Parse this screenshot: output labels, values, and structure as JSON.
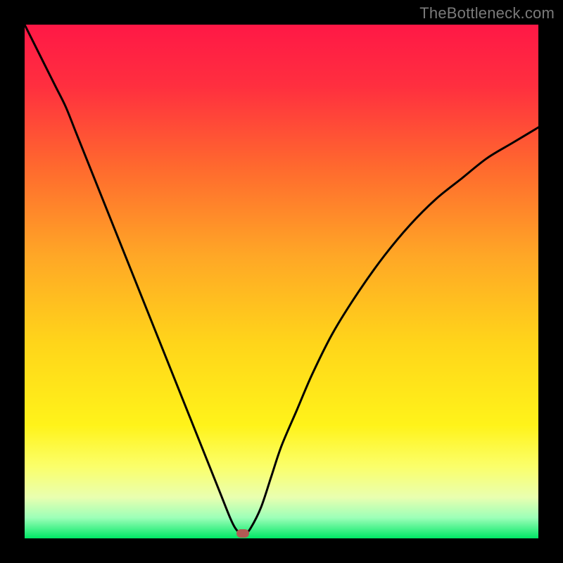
{
  "watermark": "TheBottleneck.com",
  "chart_data": {
    "type": "line",
    "title": "",
    "xlabel": "",
    "ylabel": "",
    "xlim": [
      0,
      100
    ],
    "ylim": [
      0,
      100
    ],
    "gradient_stops": [
      {
        "pos": 0.0,
        "color": "#ff1846"
      },
      {
        "pos": 0.12,
        "color": "#ff2f3f"
      },
      {
        "pos": 0.28,
        "color": "#ff6a2e"
      },
      {
        "pos": 0.45,
        "color": "#ffa726"
      },
      {
        "pos": 0.62,
        "color": "#ffd51a"
      },
      {
        "pos": 0.78,
        "color": "#fff31a"
      },
      {
        "pos": 0.86,
        "color": "#fbff6a"
      },
      {
        "pos": 0.92,
        "color": "#e9ffb0"
      },
      {
        "pos": 0.96,
        "color": "#9cffb8"
      },
      {
        "pos": 1.0,
        "color": "#00e765"
      }
    ],
    "series": [
      {
        "name": "bottleneck-curve",
        "x": [
          0,
          2,
          4,
          6,
          8,
          10,
          12,
          14,
          16,
          18,
          20,
          22,
          24,
          26,
          28,
          30,
          32,
          34,
          36,
          38,
          40,
          41,
          42,
          43,
          44,
          46,
          48,
          50,
          53,
          56,
          60,
          65,
          70,
          75,
          80,
          85,
          90,
          95,
          100
        ],
        "values": [
          100,
          96,
          92,
          88,
          84,
          79,
          74,
          69,
          64,
          59,
          54,
          49,
          44,
          39,
          34,
          29,
          24,
          19,
          14,
          9,
          4,
          2,
          1,
          1,
          2,
          6,
          12,
          18,
          25,
          32,
          40,
          48,
          55,
          61,
          66,
          70,
          74,
          77,
          80
        ]
      }
    ],
    "marker": {
      "x": 42.5,
      "y": 1
    }
  }
}
